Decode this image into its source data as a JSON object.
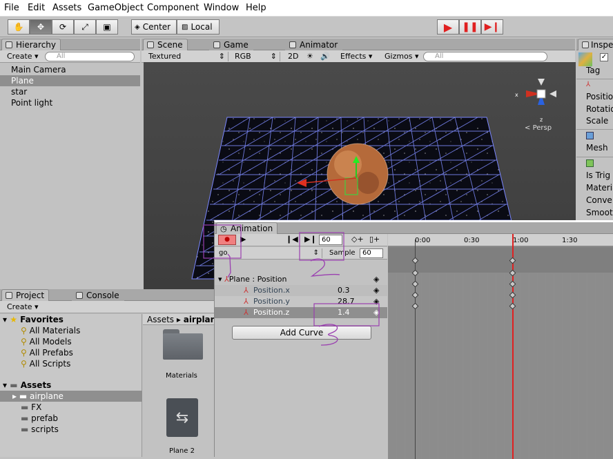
{
  "menubar": {
    "items": [
      "File",
      "Edit",
      "Assets",
      "GameObject",
      "Component",
      "Window",
      "Help"
    ]
  },
  "toolbar": {
    "center_label": "Center",
    "local_label": "Local",
    "colors": {
      "play_red": "#e02020"
    }
  },
  "hierarchy": {
    "tab": "Hierarchy",
    "create": "Create",
    "search_placeholder": "All",
    "items": [
      "Main Camera",
      "Plane",
      "star",
      "Point light"
    ],
    "selected_index": 1
  },
  "scene": {
    "tabs": [
      "Scene",
      "Game",
      "Animator"
    ],
    "active_tab": "Scene",
    "shading": "Textured",
    "render_mode": "RGB",
    "mode_2d": "2D",
    "effects": "Effects",
    "gizmos": "Gizmos",
    "search_placeholder": "All",
    "gizmo_x": "x",
    "gizmo_z": "z",
    "persp": "Persp"
  },
  "inspector": {
    "tab": "Inspe",
    "tag_label": "Tag",
    "rows": [
      "Positio",
      "Rotatio",
      "Scale",
      "Mesh",
      "Is Trig",
      "Materia",
      "Conve",
      "Smoot"
    ]
  },
  "project": {
    "tabs": [
      "Project",
      "Console"
    ],
    "create": "Create",
    "favorites_label": "Favorites",
    "favorites": [
      "All Materials",
      "All Models",
      "All Prefabs",
      "All Scripts"
    ],
    "assets_label": "Assets",
    "folders": [
      "airplane",
      "FX",
      "prefab",
      "scripts"
    ],
    "selected_folder": "airplane",
    "breadcrumb": [
      "Assets",
      "airplan"
    ],
    "grid_items": [
      "Materials",
      "Plane 2"
    ]
  },
  "animation": {
    "tab": "Animation",
    "frame": "60",
    "clip": "go",
    "sample_label": "Sample",
    "sample_value": "60",
    "curve_title": "Plane : Position",
    "properties": [
      {
        "name": "Position.x",
        "value": "0.3"
      },
      {
        "name": "Position.y",
        "value": "28.7"
      },
      {
        "name": "Position.z",
        "value": "1.4"
      }
    ],
    "selected_property": 2,
    "add_curve": "Add Curve",
    "ticks": [
      "0:00",
      "0:30",
      "1:00",
      "1:30"
    ],
    "playhead_time": "1:00",
    "annotations": [
      "1",
      "2",
      "3"
    ]
  }
}
